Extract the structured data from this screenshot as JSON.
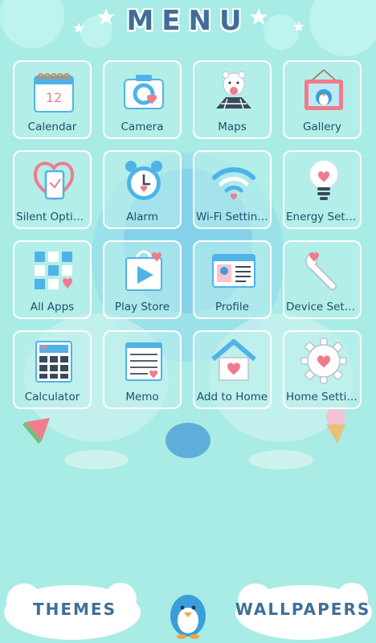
{
  "header": {
    "title": "MENU"
  },
  "apps": [
    {
      "label": "Calendar",
      "icon": "calendar-icon",
      "date_number": "12"
    },
    {
      "label": "Camera",
      "icon": "camera-icon"
    },
    {
      "label": "Maps",
      "icon": "map-icon"
    },
    {
      "label": "Gallery",
      "icon": "gallery-icon"
    },
    {
      "label": "Silent Options",
      "icon": "silent-phone-icon"
    },
    {
      "label": "Alarm",
      "icon": "alarm-clock-icon"
    },
    {
      "label": "Wi-Fi Settings",
      "icon": "wifi-icon"
    },
    {
      "label": "Energy Settings",
      "icon": "light-bulb-icon"
    },
    {
      "label": "All Apps",
      "icon": "app-grid-icon"
    },
    {
      "label": "Play Store",
      "icon": "play-store-icon"
    },
    {
      "label": "Profile",
      "icon": "profile-card-icon"
    },
    {
      "label": "Device Settings",
      "icon": "wrench-icon"
    },
    {
      "label": "Calculator",
      "icon": "calculator-icon"
    },
    {
      "label": "Memo",
      "icon": "memo-icon"
    },
    {
      "label": "Add to Home",
      "icon": "house-icon"
    },
    {
      "label": "Home Settings",
      "icon": "gear-icon"
    }
  ],
  "footer": {
    "themes_label": "THEMES",
    "wallpapers_label": "WALLPAPERS"
  },
  "colors": {
    "background": "#a8ece5",
    "accent_blue": "#4fb3e8",
    "heart_pink": "#f07b8c",
    "title_blue": "#3f6f97"
  }
}
